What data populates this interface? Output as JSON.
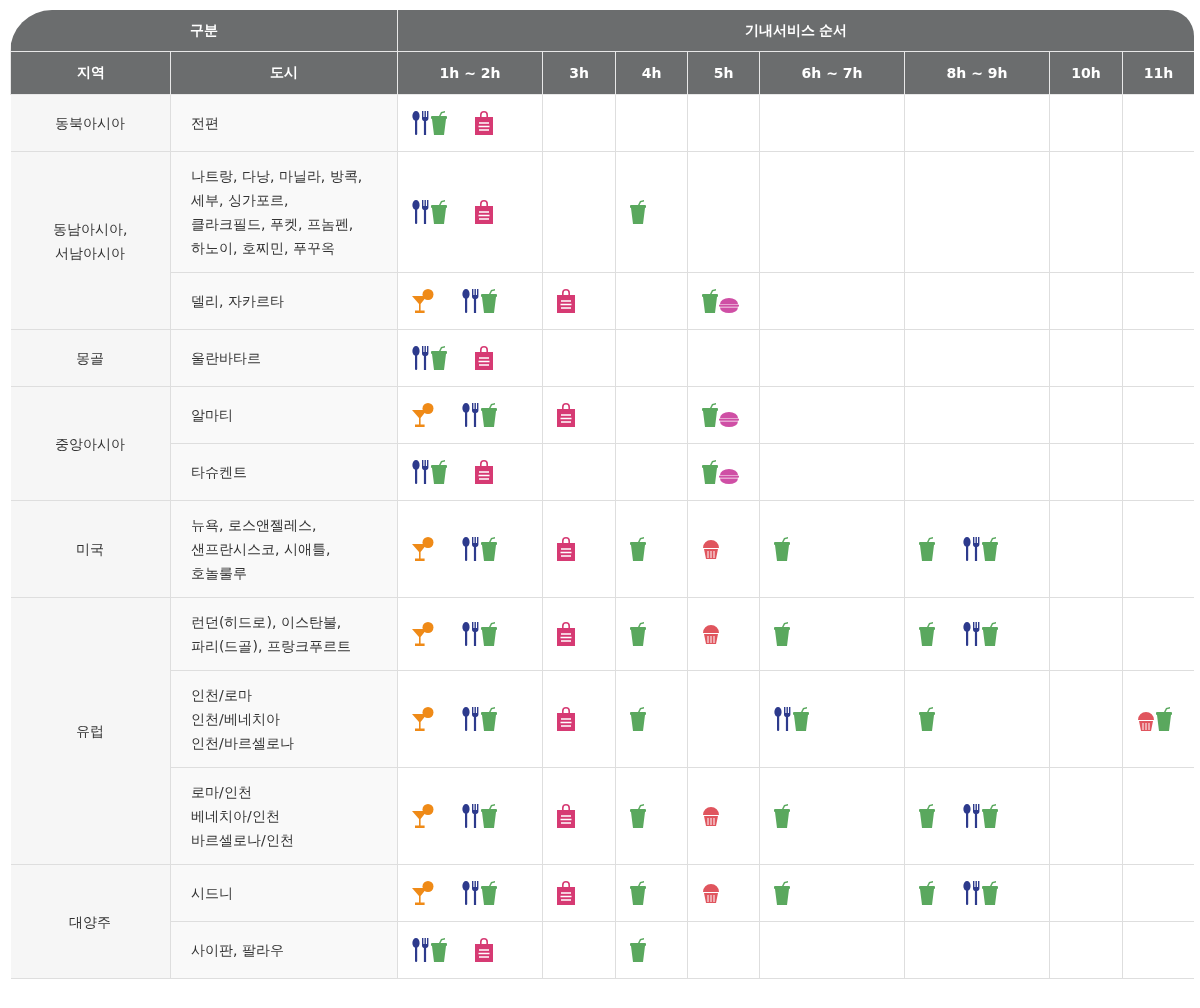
{
  "table": {
    "group_headers": [
      "구분",
      "기내서비스 순서"
    ],
    "columns": [
      "지역",
      "도시",
      "1h ~ 2h",
      "3h",
      "4h",
      "5h",
      "6h ~ 7h",
      "8h ~ 9h",
      "10h",
      "11h"
    ],
    "regions": [
      {
        "name": "동북아시아",
        "cities": [
          {
            "name": "전편",
            "cells": [
              {
                "groups": [
                  [
                    {
                      "kind": "meal"
                    },
                    {
                      "kind": "drink"
                    }
                  ],
                  [
                    {
                      "kind": "dutyfree"
                    }
                  ]
                ]
              },
              {},
              {},
              {},
              {},
              {},
              {},
              {}
            ]
          }
        ]
      },
      {
        "name": "동남아시아,\n서남아시아",
        "cities": [
          {
            "name": "나트랑, 다낭, 마닐라, 방콕,\n세부, 싱가포르,\n클라크필드, 푸켓, 프놈펜,\n하노이, 호찌민, 푸꾸옥",
            "cells": [
              {
                "groups": [
                  [
                    {
                      "kind": "meal"
                    },
                    {
                      "kind": "drink"
                    }
                  ],
                  [
                    {
                      "kind": "dutyfree"
                    }
                  ]
                ]
              },
              {},
              {
                "groups": [
                  [
                    {
                      "kind": "drink"
                    }
                  ]
                ]
              },
              {},
              {},
              {},
              {},
              {}
            ]
          },
          {
            "name": "델리, 자카르타",
            "cells": [
              {
                "groups": [
                  [
                    {
                      "kind": "cocktail"
                    }
                  ],
                  [
                    {
                      "kind": "meal"
                    },
                    {
                      "kind": "drink"
                    }
                  ]
                ]
              },
              {
                "groups": [
                  [
                    {
                      "kind": "dutyfree"
                    }
                  ]
                ]
              },
              {},
              {
                "groups": [
                  [
                    {
                      "kind": "drink"
                    },
                    {
                      "kind": "macaron"
                    }
                  ]
                ]
              },
              {},
              {},
              {},
              {}
            ]
          }
        ]
      },
      {
        "name": "몽골",
        "cities": [
          {
            "name": "울란바타르",
            "cells": [
              {
                "groups": [
                  [
                    {
                      "kind": "meal"
                    },
                    {
                      "kind": "drink"
                    }
                  ],
                  [
                    {
                      "kind": "dutyfree"
                    }
                  ]
                ]
              },
              {},
              {},
              {},
              {},
              {},
              {},
              {}
            ]
          }
        ]
      },
      {
        "name": "중앙아시아",
        "cities": [
          {
            "name": "알마티",
            "cells": [
              {
                "groups": [
                  [
                    {
                      "kind": "cocktail"
                    }
                  ],
                  [
                    {
                      "kind": "meal"
                    },
                    {
                      "kind": "drink"
                    }
                  ]
                ]
              },
              {
                "groups": [
                  [
                    {
                      "kind": "dutyfree"
                    }
                  ]
                ]
              },
              {},
              {
                "groups": [
                  [
                    {
                      "kind": "drink"
                    },
                    {
                      "kind": "macaron"
                    }
                  ]
                ]
              },
              {},
              {},
              {},
              {}
            ]
          },
          {
            "name": "타슈켄트",
            "cells": [
              {
                "groups": [
                  [
                    {
                      "kind": "meal"
                    },
                    {
                      "kind": "drink"
                    }
                  ],
                  [
                    {
                      "kind": "dutyfree"
                    }
                  ]
                ]
              },
              {},
              {},
              {
                "groups": [
                  [
                    {
                      "kind": "drink"
                    },
                    {
                      "kind": "macaron"
                    }
                  ]
                ]
              },
              {},
              {},
              {},
              {}
            ]
          }
        ]
      },
      {
        "name": "미국",
        "cities": [
          {
            "name": "뉴욕, 로스앤젤레스,\n샌프란시스코, 시애틀,\n호놀룰루",
            "cells": [
              {
                "groups": [
                  [
                    {
                      "kind": "cocktail"
                    }
                  ],
                  [
                    {
                      "kind": "meal"
                    },
                    {
                      "kind": "drink"
                    }
                  ]
                ]
              },
              {
                "groups": [
                  [
                    {
                      "kind": "dutyfree"
                    }
                  ]
                ]
              },
              {
                "groups": [
                  [
                    {
                      "kind": "drink"
                    }
                  ]
                ]
              },
              {
                "groups": [
                  [
                    {
                      "kind": "cupcake"
                    }
                  ]
                ]
              },
              {
                "groups": [
                  [
                    {
                      "kind": "drink"
                    }
                  ]
                ]
              },
              {
                "groups": [
                  [
                    {
                      "kind": "drink"
                    }
                  ],
                  [
                    {
                      "kind": "meal"
                    },
                    {
                      "kind": "drink"
                    }
                  ]
                ]
              },
              {},
              {}
            ]
          }
        ]
      },
      {
        "name": "유럽",
        "cities": [
          {
            "name": "런던(히드로), 이스탄불,\n파리(드골), 프랑크푸르트",
            "cells": [
              {
                "groups": [
                  [
                    {
                      "kind": "cocktail"
                    }
                  ],
                  [
                    {
                      "kind": "meal"
                    },
                    {
                      "kind": "drink"
                    }
                  ]
                ]
              },
              {
                "groups": [
                  [
                    {
                      "kind": "dutyfree"
                    }
                  ]
                ]
              },
              {
                "groups": [
                  [
                    {
                      "kind": "drink"
                    }
                  ]
                ]
              },
              {
                "groups": [
                  [
                    {
                      "kind": "cupcake"
                    }
                  ]
                ]
              },
              {
                "groups": [
                  [
                    {
                      "kind": "drink"
                    }
                  ]
                ]
              },
              {
                "groups": [
                  [
                    {
                      "kind": "drink"
                    }
                  ],
                  [
                    {
                      "kind": "meal"
                    },
                    {
                      "kind": "drink"
                    }
                  ]
                ]
              },
              {},
              {}
            ]
          },
          {
            "name": "인천/로마\n인천/베네치아\n인천/바르셀로나",
            "cells": [
              {
                "groups": [
                  [
                    {
                      "kind": "cocktail"
                    }
                  ],
                  [
                    {
                      "kind": "meal"
                    },
                    {
                      "kind": "drink"
                    }
                  ]
                ]
              },
              {
                "groups": [
                  [
                    {
                      "kind": "dutyfree"
                    }
                  ]
                ]
              },
              {
                "groups": [
                  [
                    {
                      "kind": "drink"
                    }
                  ]
                ]
              },
              {},
              {
                "groups": [
                  [
                    {
                      "kind": "meal"
                    },
                    {
                      "kind": "drink"
                    }
                  ]
                ]
              },
              {
                "groups": [
                  [
                    {
                      "kind": "drink"
                    }
                  ]
                ]
              },
              {},
              {
                "groups": [
                  [
                    {
                      "kind": "cupcake"
                    },
                    {
                      "kind": "drink"
                    }
                  ]
                ]
              }
            ]
          },
          {
            "name": "로마/인천\n베네치아/인천\n바르셀로나/인천",
            "cells": [
              {
                "groups": [
                  [
                    {
                      "kind": "cocktail"
                    }
                  ],
                  [
                    {
                      "kind": "meal"
                    },
                    {
                      "kind": "drink"
                    }
                  ]
                ]
              },
              {
                "groups": [
                  [
                    {
                      "kind": "dutyfree"
                    }
                  ]
                ]
              },
              {
                "groups": [
                  [
                    {
                      "kind": "drink"
                    }
                  ]
                ]
              },
              {
                "groups": [
                  [
                    {
                      "kind": "cupcake"
                    }
                  ]
                ]
              },
              {
                "groups": [
                  [
                    {
                      "kind": "drink"
                    }
                  ]
                ]
              },
              {
                "groups": [
                  [
                    {
                      "kind": "drink"
                    }
                  ],
                  [
                    {
                      "kind": "meal"
                    },
                    {
                      "kind": "drink"
                    }
                  ]
                ]
              },
              {},
              {}
            ]
          }
        ]
      },
      {
        "name": "대양주",
        "cities": [
          {
            "name": "시드니",
            "cells": [
              {
                "groups": [
                  [
                    {
                      "kind": "cocktail"
                    }
                  ],
                  [
                    {
                      "kind": "meal"
                    },
                    {
                      "kind": "drink"
                    }
                  ]
                ]
              },
              {
                "groups": [
                  [
                    {
                      "kind": "dutyfree"
                    }
                  ]
                ]
              },
              {
                "groups": [
                  [
                    {
                      "kind": "drink"
                    }
                  ]
                ]
              },
              {
                "groups": [
                  [
                    {
                      "kind": "cupcake"
                    }
                  ]
                ]
              },
              {
                "groups": [
                  [
                    {
                      "kind": "drink"
                    }
                  ]
                ]
              },
              {
                "groups": [
                  [
                    {
                      "kind": "drink"
                    }
                  ],
                  [
                    {
                      "kind": "meal"
                    },
                    {
                      "kind": "drink"
                    }
                  ]
                ]
              },
              {},
              {}
            ]
          },
          {
            "name": "사이판, 팔라우",
            "cells": [
              {
                "groups": [
                  [
                    {
                      "kind": "meal"
                    },
                    {
                      "kind": "drink"
                    }
                  ],
                  [
                    {
                      "kind": "dutyfree"
                    }
                  ]
                ]
              },
              {},
              {
                "groups": [
                  [
                    {
                      "kind": "drink"
                    }
                  ]
                ]
              },
              {},
              {},
              {},
              {},
              {}
            ]
          }
        ]
      }
    ]
  }
}
